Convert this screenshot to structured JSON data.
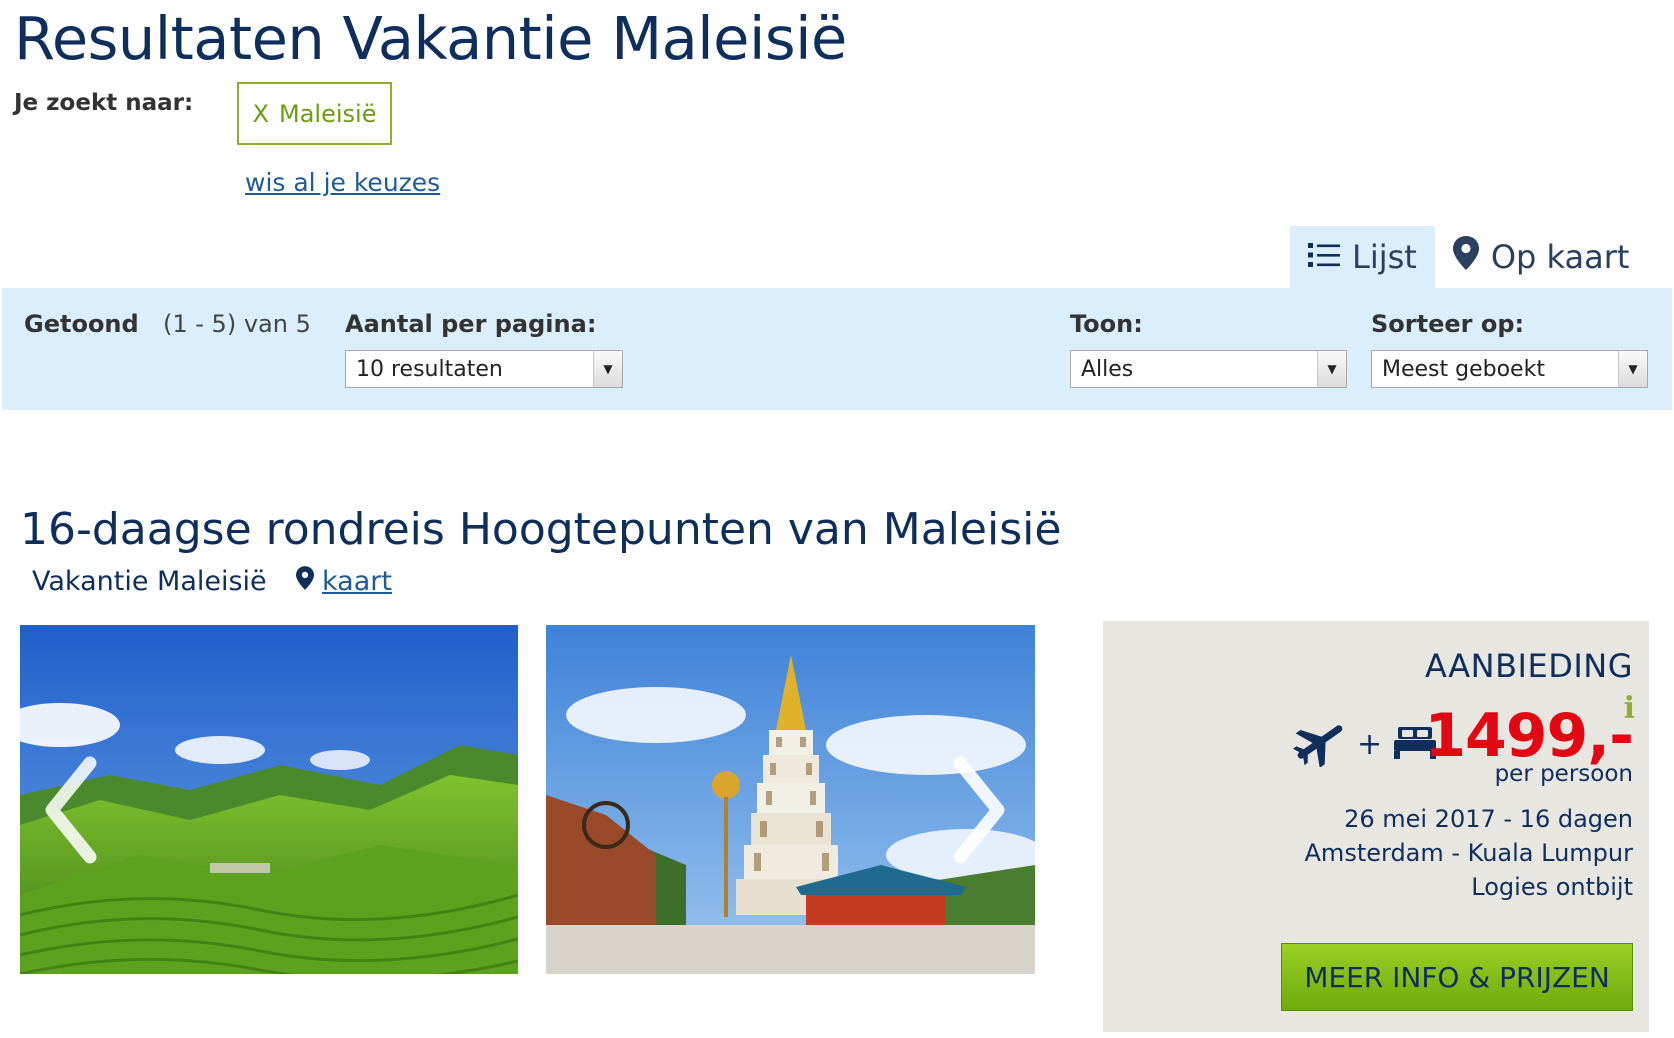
{
  "header": {
    "title": "Resultaten Vakantie Maleisië",
    "search_label": "Je zoekt naar:",
    "chip_x": "X",
    "chip_label": "Maleisië",
    "clear_link": "wis al je keuzes"
  },
  "view_tabs": {
    "list_label": "Lijst",
    "list_icon": "list-icon",
    "map_label": "Op kaart",
    "map_icon": "map-pin-icon"
  },
  "filter_bar": {
    "shown_label": "Getoond",
    "shown_count": "(1 - 5) van 5",
    "per_page_label": "Aantal per pagina:",
    "per_page_value": "10 resultaten",
    "show_label": "Toon:",
    "show_value": "Alles",
    "sort_label": "Sorteer op:",
    "sort_value": "Meest geboekt"
  },
  "result": {
    "title": "16-daagse rondreis Hoogtepunten van Maleisië",
    "subtitle": "Vakantie Maleisië",
    "map_link": "kaart",
    "offer": {
      "label": "AANBIEDING",
      "plus": "+",
      "price": "1499,-",
      "info": "i",
      "per_person": "per persoon",
      "date_duration": "26 mei 2017 - 16 dagen",
      "route": "Amsterdam  -  Kuala Lumpur",
      "board": "Logies ontbijt",
      "cta": "MEER INFO & PRIJZEN"
    }
  },
  "colors": {
    "navy": "#0f2e5c",
    "link": "#1f5b99",
    "green": "#8db032",
    "price_red": "#e30613",
    "filter_bg": "#dbeefb",
    "offer_bg": "#e8e6e1"
  }
}
